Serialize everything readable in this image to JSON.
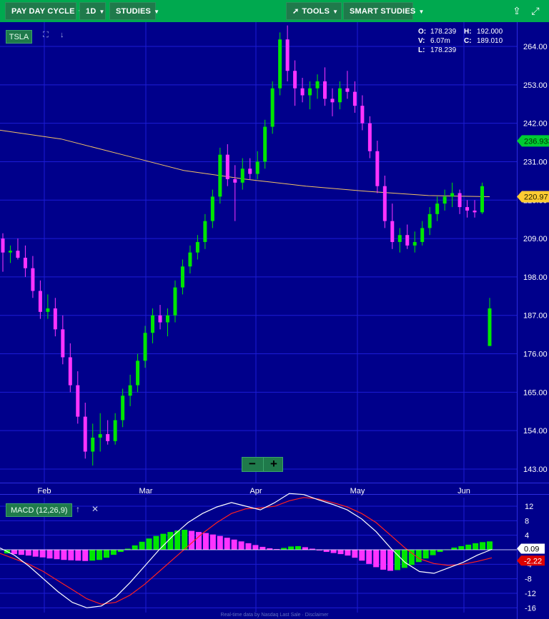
{
  "toolbar": {
    "pay_day_cycle": "PAY DAY CYCLE",
    "interval": "1D",
    "studies": "STUDIES",
    "tools": "TOOLS",
    "smart_studies": "SMART STUDIES"
  },
  "symbol": "TSLA",
  "ohlc": {
    "o_label": "O:",
    "o": "178.239",
    "h_label": "H:",
    "h": "192.000",
    "v_label": "V:",
    "v": "6.07m",
    "c_label": "C:",
    "c": "189.010",
    "l_label": "L:",
    "l": "178.239"
  },
  "macd_label": "MACD (12,26,9)",
  "footer": "Real-time data by Nasdaq Last Sale · Disclaimer",
  "colors": {
    "background": "#00008b",
    "grid": "#1c1cd6",
    "up": "#00e600",
    "down": "#ff33ff",
    "ma": "#f2c166",
    "macd_line": "#ffffff",
    "signal_line": "#ff2020"
  },
  "chart_data": [
    {
      "type": "candlestick",
      "symbol": "TSLA",
      "x_labels": [
        "Feb",
        "Mar",
        "Apr",
        "May",
        "Jun"
      ],
      "y_ticks": [
        "143.00",
        "154.00",
        "165.00",
        "176.00",
        "187.00",
        "198.00",
        "209.00",
        "220.00",
        "231.00",
        "242.00",
        "253.00",
        "264.00"
      ],
      "ylim": [
        143,
        264
      ],
      "price_tags": {
        "last": "236.933",
        "ma": "220.97"
      },
      "moving_average": [
        240.0,
        237.5,
        233.0,
        228.5,
        226.0,
        224.0,
        222.5,
        221.3,
        220.97
      ],
      "candles": [
        [
          209.0,
          210.5,
          199.5,
          205.0
        ],
        [
          205.0,
          207.0,
          202.0,
          205.5
        ],
        [
          205.5,
          209.0,
          203.0,
          203.5
        ],
        [
          203.5,
          207.0,
          198.0,
          200.5
        ],
        [
          200.5,
          204.0,
          192.0,
          194.0
        ],
        [
          194.0,
          197.0,
          186.0,
          188.0
        ],
        [
          188.0,
          193.0,
          186.0,
          189.0
        ],
        [
          189.0,
          192.0,
          181.0,
          183.0
        ],
        [
          183.0,
          187.0,
          173.0,
          175.0
        ],
        [
          175.0,
          179.0,
          165.0,
          167.0
        ],
        [
          167.0,
          171.0,
          156.0,
          158.0
        ],
        [
          158.0,
          162.0,
          146.0,
          148.0
        ],
        [
          148.0,
          156.0,
          144.0,
          152.0
        ],
        [
          152.0,
          159.0,
          148.0,
          153.0
        ],
        [
          153.0,
          157.0,
          150.0,
          151.0
        ],
        [
          151.0,
          159.0,
          150.0,
          157.0
        ],
        [
          157.0,
          166.0,
          155.0,
          164.0
        ],
        [
          164.0,
          170.0,
          161.0,
          167.0
        ],
        [
          167.0,
          176.0,
          165.0,
          174.0
        ],
        [
          174.0,
          184.0,
          172.0,
          182.0
        ],
        [
          182.0,
          189.0,
          179.0,
          187.0
        ],
        [
          187.0,
          190.0,
          183.0,
          185.0
        ],
        [
          185.0,
          189.0,
          181.0,
          187.0
        ],
        [
          187.0,
          197.0,
          185.0,
          195.0
        ],
        [
          195.0,
          203.0,
          193.0,
          201.0
        ],
        [
          201.0,
          207.0,
          199.0,
          205.0
        ],
        [
          205.0,
          210.0,
          203.0,
          208.0
        ],
        [
          208.0,
          216.0,
          206.0,
          214.0
        ],
        [
          214.0,
          223.0,
          212.0,
          221.0
        ],
        [
          221.0,
          235.0,
          219.0,
          233.0
        ],
        [
          233.0,
          236.0,
          224.0,
          226.0
        ],
        [
          226.0,
          230.0,
          214.0,
          225.0
        ],
        [
          225.0,
          232.0,
          223.0,
          229.0
        ],
        [
          229.0,
          232.0,
          226.0,
          227.5
        ],
        [
          227.5,
          234.0,
          226.0,
          231.0
        ],
        [
          231.0,
          243.0,
          229.0,
          241.0
        ],
        [
          241.0,
          254.0,
          239.0,
          252.0
        ],
        [
          252.0,
          268.0,
          250.0,
          266.0
        ],
        [
          266.0,
          270.0,
          254.0,
          257.0
        ],
        [
          257.0,
          260.0,
          247.0,
          252.0
        ],
        [
          252.0,
          255.0,
          248.0,
          250.0
        ],
        [
          250.0,
          254.0,
          246.0,
          252.0
        ],
        [
          252.0,
          256.0,
          249.0,
          254.0
        ],
        [
          254.0,
          258.0,
          247.0,
          249.0
        ],
        [
          249.0,
          252.0,
          244.0,
          248.0
        ],
        [
          248.0,
          254.0,
          246.0,
          252.0
        ],
        [
          252.0,
          257.0,
          249.0,
          251.0
        ],
        [
          251.0,
          254.0,
          245.0,
          247.0
        ],
        [
          247.0,
          250.0,
          240.0,
          242.0
        ],
        [
          242.0,
          244.0,
          232.0,
          234.0
        ],
        [
          234.0,
          237.0,
          222.0,
          224.0
        ],
        [
          224.0,
          227.0,
          212.0,
          214.0
        ],
        [
          214.0,
          219.0,
          206.0,
          208.0
        ],
        [
          208.0,
          212.0,
          205.0,
          210.0
        ],
        [
          210.0,
          213.0,
          206.0,
          207.0
        ],
        [
          207.0,
          211.0,
          205.0,
          208.0
        ],
        [
          208.0,
          214.0,
          207.0,
          212.0
        ],
        [
          212.0,
          218.0,
          210.0,
          216.0
        ],
        [
          216.0,
          221.0,
          214.0,
          219.0
        ],
        [
          219.0,
          223.0,
          217.0,
          221.0
        ],
        [
          221.0,
          225.0,
          218.0,
          222.0
        ],
        [
          222.0,
          223.0,
          216.0,
          218.0
        ],
        [
          218.0,
          220.0,
          215.0,
          217.0
        ],
        [
          217.0,
          220.0,
          215.0,
          216.5
        ],
        [
          216.5,
          225.0,
          216.0,
          224.0
        ],
        [
          178.239,
          192.0,
          178.239,
          189.01
        ]
      ]
    },
    {
      "type": "macd",
      "name": "MACD (12,26,9)",
      "y_ticks": [
        "12",
        "8",
        "4",
        "0",
        "-4",
        "-8",
        "-12",
        "-16"
      ],
      "ylim": [
        -16,
        12
      ],
      "value_tags": {
        "macd": "0.09",
        "signal": "-2.22"
      },
      "histogram": [
        -1.0,
        -1.2,
        -1.4,
        -1.6,
        -1.9,
        -2.1,
        -2.4,
        -2.6,
        -2.8,
        -2.9,
        -3.0,
        -3.1,
        -3.0,
        -2.8,
        -2.2,
        -1.4,
        -0.6,
        0.3,
        1.2,
        2.2,
        3.1,
        3.8,
        4.4,
        4.9,
        5.3,
        5.5,
        5.2,
        4.9,
        4.6,
        4.2,
        3.8,
        3.3,
        2.8,
        2.3,
        1.8,
        1.3,
        0.8,
        0.4,
        0.2,
        0.5,
        0.9,
        1.0,
        0.7,
        0.3,
        -0.2,
        -0.6,
        -0.9,
        -1.2,
        -1.6,
        -2.2,
        -3.0,
        -3.9,
        -4.8,
        -5.5,
        -5.8,
        -5.6,
        -5.0,
        -4.2,
        -3.4,
        -2.4,
        -1.5,
        -0.6,
        0.1,
        0.6,
        1.0,
        1.4,
        1.8,
        2.1,
        2.3
      ],
      "macd_line": [
        0.5,
        -1.5,
        -4.5,
        -8.0,
        -11.5,
        -14.5,
        -16.0,
        -15.5,
        -13.0,
        -9.0,
        -4.5,
        0.0,
        4.0,
        7.5,
        10.0,
        11.8,
        13.0,
        12.0,
        11.0,
        13.0,
        15.5,
        15.2,
        13.8,
        12.5,
        11.0,
        8.5,
        5.0,
        0.5,
        -3.5,
        -6.0,
        -6.5,
        -5.0,
        -3.5,
        -1.5,
        0.09
      ],
      "signal_line": [
        -1.0,
        -2.5,
        -4.0,
        -6.0,
        -8.5,
        -11.0,
        -13.5,
        -15.0,
        -14.5,
        -12.5,
        -9.5,
        -6.0,
        -2.5,
        1.0,
        4.5,
        7.5,
        10.0,
        11.3,
        11.5,
        12.0,
        13.5,
        14.4,
        14.0,
        13.0,
        11.8,
        10.0,
        7.5,
        4.0,
        0.5,
        -2.5,
        -3.8,
        -4.3,
        -4.0,
        -3.2,
        -2.22
      ]
    }
  ]
}
